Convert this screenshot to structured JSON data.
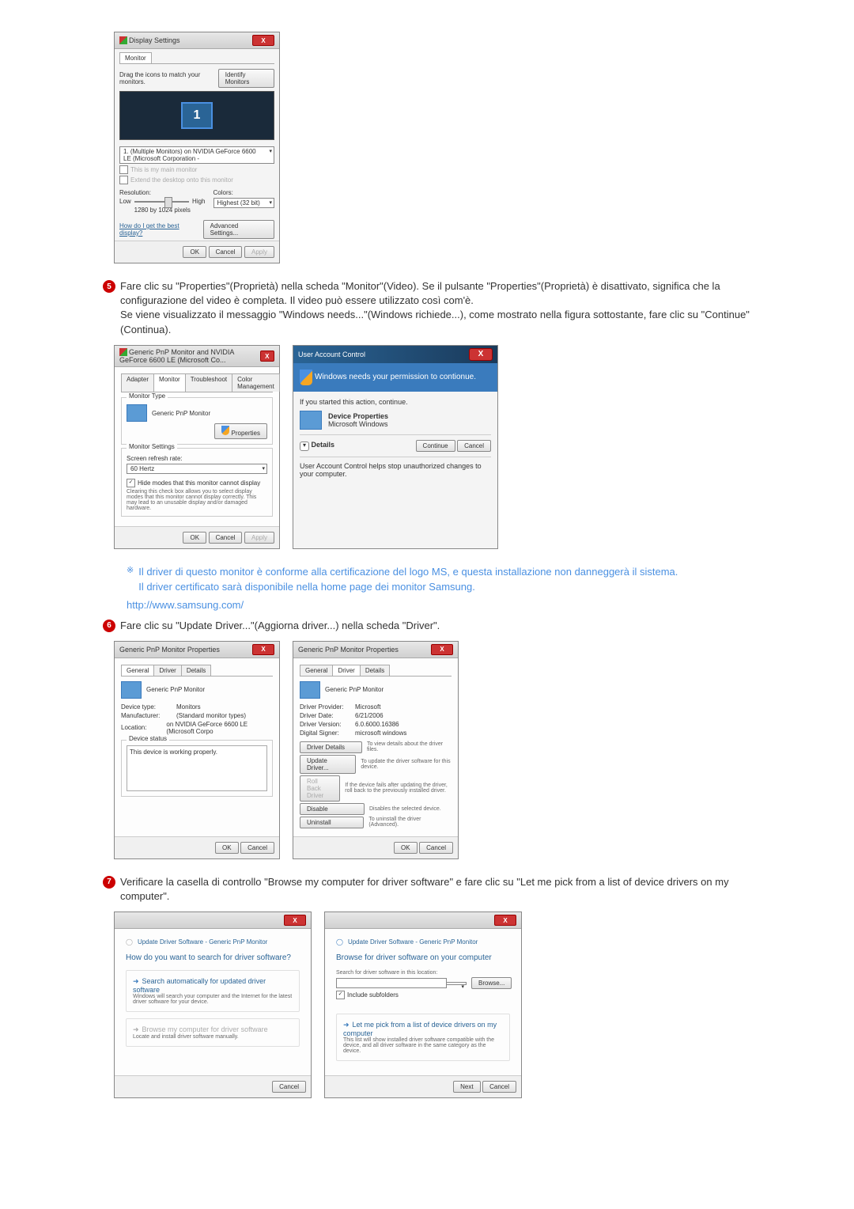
{
  "display_settings": {
    "title": "Display Settings",
    "tab_monitor": "Monitor",
    "drag_text": "Drag the icons to match your monitors.",
    "identify": "Identify Monitors",
    "monitor_num": "1",
    "monitor_select": "1. (Multiple Monitors) on NVIDIA GeForce 6600 LE (Microsoft Corporation -",
    "cb_main": "This is my main monitor",
    "cb_extend": "Extend the desktop onto this monitor",
    "resolution_label": "Resolution:",
    "low": "Low",
    "high": "High",
    "res_value": "1280 by 1024 pixels",
    "colors_label": "Colors:",
    "colors_value": "Highest (32 bit)",
    "how_link": "How do I get the best display?",
    "advanced": "Advanced Settings...",
    "ok": "OK",
    "cancel": "Cancel",
    "apply": "Apply"
  },
  "step5": {
    "num": "5",
    "text": "Fare clic su \"Properties\"(Proprietà) nella scheda \"Monitor\"(Video). Se il pulsante \"Properties\"(Proprietà) è disattivato, significa che la configurazione del video è completa. Il video può essere utilizzato così com'è.\nSe viene visualizzato il messaggio \"Windows needs...\"(Windows richiede...), come mostrato nella figura sottostante, fare clic su \"Continue\"(Continua)."
  },
  "monitor_props": {
    "title": "Generic PnP Monitor and NVIDIA GeForce 6600 LE (Microsoft Co...",
    "tab_adapter": "Adapter",
    "tab_monitor": "Monitor",
    "tab_troubleshoot": "Troubleshoot",
    "tab_color": "Color Management",
    "type_group": "Monitor Type",
    "type_value": "Generic PnP Monitor",
    "properties_btn": "Properties",
    "settings_group": "Monitor Settings",
    "refresh_label": "Screen refresh rate:",
    "refresh_value": "60 Hertz",
    "cb_hide": "Hide modes that this monitor cannot display",
    "hide_desc": "Clearing this check box allows you to select display modes that this monitor cannot display correctly. This may lead to an unusable display and/or damaged hardware.",
    "ok": "OK",
    "cancel": "Cancel",
    "apply": "Apply"
  },
  "uac": {
    "title": "User Account Control",
    "msg": "Windows needs your permission to contionue.",
    "started": "If you started this action, continue.",
    "prog": "Device Properties",
    "publisher": "Microsoft Windows",
    "details": "Details",
    "continue": "Continue",
    "cancel": "Cancel",
    "footer": "User Account Control helps stop unauthorized changes to your computer."
  },
  "note": {
    "text": "Il driver di questo monitor è conforme alla certificazione del logo MS, e questa installazione non danneggerà il sistema.\nIl driver certificato sarà disponibile nella home page dei monitor Samsung."
  },
  "samsung_link": "http://www.samsung.com/",
  "step6": {
    "num": "6",
    "text": "Fare clic su \"Update Driver...\"(Aggiorna driver...) nella scheda \"Driver\"."
  },
  "props_general": {
    "title": "Generic PnP Monitor Properties",
    "tab_general": "General",
    "tab_driver": "Driver",
    "tab_details": "Details",
    "name": "Generic PnP Monitor",
    "dev_type_l": "Device type:",
    "dev_type_v": "Monitors",
    "manuf_l": "Manufacturer:",
    "manuf_v": "(Standard monitor types)",
    "loc_l": "Location:",
    "loc_v": "on NVIDIA GeForce 6600 LE (Microsoft Corpo",
    "status_group": "Device status",
    "status_text": "This device is working properly.",
    "ok": "OK",
    "cancel": "Cancel"
  },
  "props_driver": {
    "title": "Generic PnP Monitor Properties",
    "tab_general": "General",
    "tab_driver": "Driver",
    "tab_details": "Details",
    "name": "Generic PnP Monitor",
    "provider_l": "Driver Provider:",
    "provider_v": "Microsoft",
    "date_l": "Driver Date:",
    "date_v": "6/21/2006",
    "version_l": "Driver Version:",
    "version_v": "6.0.6000.16386",
    "signer_l": "Digital Signer:",
    "signer_v": "microsoft windows",
    "btn_details": "Driver Details",
    "btn_details_d": "To view details about the driver files.",
    "btn_update": "Update Driver...",
    "btn_update_d": "To update the driver software for this device.",
    "btn_rollback": "Roll Back Driver",
    "btn_rollback_d": "If the device fails after updating the driver, roll back to the previously installed driver.",
    "btn_disable": "Disable",
    "btn_disable_d": "Disables the selected device.",
    "btn_uninstall": "Uninstall",
    "btn_uninstall_d": "To uninstall the driver (Advanced).",
    "ok": "OK",
    "cancel": "Cancel"
  },
  "step7": {
    "num": "7",
    "text": "Verificare la casella di controllo \"Browse my computer for driver software\" e fare clic su \"Let me pick from a list of device drivers on my computer\"."
  },
  "wizard1": {
    "title": "Update Driver Software - Generic PnP Monitor",
    "heading": "How do you want to search for driver software?",
    "opt1_title": "Search automatically for updated driver software",
    "opt1_desc": "Windows will search your computer and the Internet for the latest driver software for your device.",
    "opt2_title": "Browse my computer for driver software",
    "opt2_desc": "Locate and install driver software manually.",
    "cancel": "Cancel"
  },
  "wizard2": {
    "title": "Update Driver Software - Generic PnP Monitor",
    "heading": "Browse for driver software on your computer",
    "search_label": "Search for driver software in this location:",
    "browse": "Browse...",
    "cb_sub": "Include subfolders",
    "opt_title": "Let me pick from a list of device drivers on my computer",
    "opt_desc": "This list will show installed driver software compatible with the device, and all driver software in the same category as the device.",
    "next": "Next",
    "cancel": "Cancel"
  }
}
